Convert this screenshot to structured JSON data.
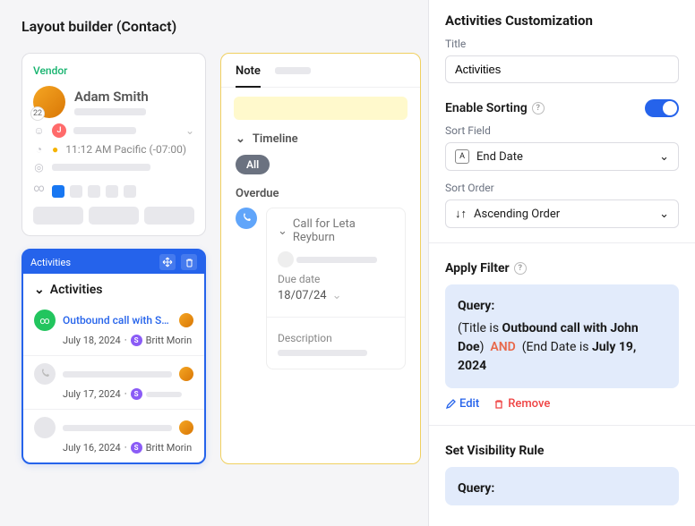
{
  "page_title": "Layout builder (Contact)",
  "contact_card": {
    "vendor_label": "Vendor",
    "name": "Adam Smith",
    "avatar_badge": "22",
    "j_chip": "J",
    "time": "11:12 AM Pacific (-07:00)"
  },
  "activities_card": {
    "header_label": "Activities",
    "title": "Activities",
    "items": [
      {
        "subject": "Outbound call with Sa...",
        "date": "July 18, 2024",
        "assignee": "Britt Morin",
        "icon": "green"
      },
      {
        "subject": "",
        "date": "July 17, 2024",
        "assignee": "",
        "icon": "grey"
      },
      {
        "subject": "",
        "date": "July 16, 2024",
        "assignee": "Britt Morin",
        "icon": "grey"
      }
    ]
  },
  "main_panel": {
    "tabs": [
      "Note"
    ],
    "timeline_label": "Timeline",
    "filter_all": "All",
    "overdue_label": "Overdue",
    "task_title": "Call for Leta Reyburn",
    "due_label": "Due date",
    "due_value": "18/07/24",
    "desc_label": "Description"
  },
  "right_panel": {
    "heading": "Activities Customization",
    "title_label": "Title",
    "title_value": "Activities",
    "enable_sorting": "Enable Sorting",
    "sort_field_label": "Sort Field",
    "sort_field_value": "End Date",
    "sort_order_label": "Sort Order",
    "sort_order_value": "Ascending Order",
    "apply_filter": "Apply Filter",
    "query_label": "Query:",
    "query_text_1": "(Title is ",
    "query_bold_1": "Outbound call with John Doe",
    "query_paren_1": ")",
    "query_and": "AND",
    "query_text_2": "(End Date is ",
    "query_bold_2": "July 19, 2024",
    "edit_label": "Edit",
    "remove_label": "Remove",
    "visibility_heading": "Set Visibility Rule",
    "query2_label": "Query:"
  }
}
